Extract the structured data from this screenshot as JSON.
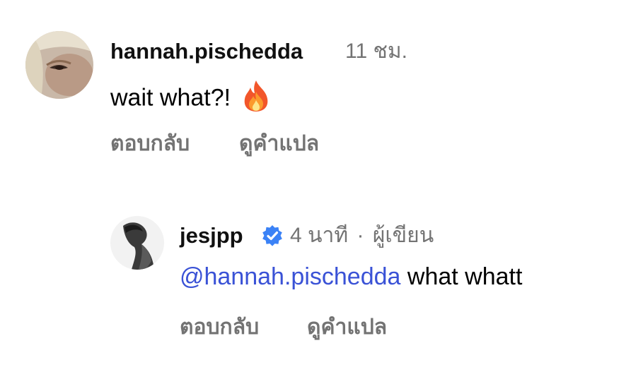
{
  "comments": [
    {
      "username": "hannah.pischedda",
      "time": "11 ชม.",
      "text": "wait what?!",
      "emoji": "fire-emoji",
      "reply_label": "ตอบกลับ",
      "translate_label": "ดูคำแปล"
    },
    {
      "username": "jesjpp",
      "verified_icon": "verified-badge-icon",
      "time": "4 นาที",
      "separator": "·",
      "author_label": "ผู้เขียน",
      "mention": "@hannah.pischedda",
      "text": "what whatt",
      "reply_label": "ตอบกลับ",
      "translate_label": "ดูคำแปล"
    }
  ],
  "colors": {
    "meta": "#737373",
    "mention": "#3a52d6",
    "verified": "#3b82f6"
  }
}
